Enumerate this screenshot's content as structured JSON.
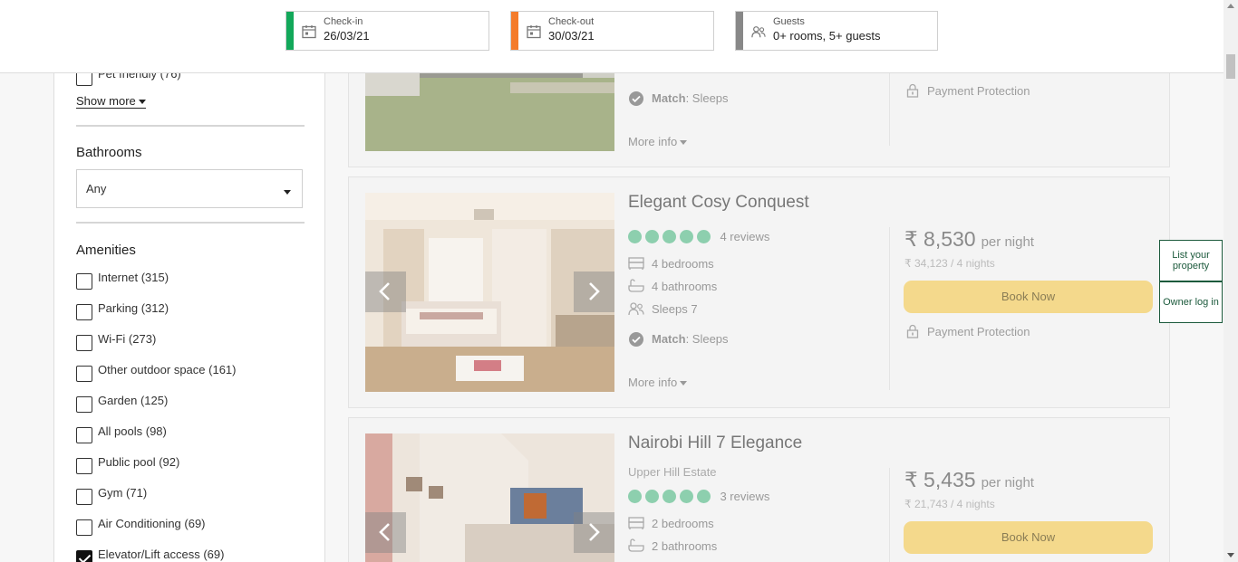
{
  "header": {
    "checkin": {
      "label": "Check-in",
      "value": "26/03/21",
      "color": "#12a85a"
    },
    "checkout": {
      "label": "Check-out",
      "value": "30/03/21",
      "color": "#f47b2a"
    },
    "guests": {
      "label": "Guests",
      "value": "0+ rooms, 5+ guests",
      "color": "#888888"
    }
  },
  "sidebar": {
    "pet_friendly": "Pet friendly (76)",
    "show_more": "Show more",
    "bathrooms_title": "Bathrooms",
    "bathrooms_value": "Any",
    "amenities_title": "Amenities",
    "amenities": [
      {
        "label": "Internet (315)",
        "checked": false
      },
      {
        "label": "Parking (312)",
        "checked": false
      },
      {
        "label": "Wi-Fi (273)",
        "checked": false
      },
      {
        "label": "Other outdoor space (161)",
        "checked": false
      },
      {
        "label": "Garden (125)",
        "checked": false
      },
      {
        "label": "All pools (98)",
        "checked": false
      },
      {
        "label": "Public pool (92)",
        "checked": false
      },
      {
        "label": "Gym (71)",
        "checked": false
      },
      {
        "label": "Air Conditioning (69)",
        "checked": false
      },
      {
        "label": "Elevator/Lift access (69)",
        "checked": true
      }
    ]
  },
  "listings": {
    "top": {
      "match_label": "Match",
      "match_value": ": Sleeps",
      "more_info": "More info",
      "payment": "Payment Protection"
    },
    "l1": {
      "title": "Elegant Cosy Conquest",
      "reviews": "4 reviews",
      "bedrooms": "4 bedrooms",
      "bathrooms": "4 bathrooms",
      "sleeps": "Sleeps 7",
      "match_label": "Match",
      "match_value": ": Sleeps",
      "more_info": "More info",
      "price": "₹ 8,530",
      "per_night": "per night",
      "total": "₹ 34,123 / 4 nights",
      "book": "Book Now",
      "payment": "Payment Protection"
    },
    "l2": {
      "title": "Nairobi Hill 7 Elegance",
      "location": "Upper Hill Estate",
      "reviews": "3 reviews",
      "bedrooms": "2 bedrooms",
      "bathrooms": "2 bathrooms",
      "price": "₹ 5,435",
      "per_night": "per night",
      "total": "₹ 21,743 / 4 nights",
      "book": "Book Now"
    }
  },
  "side_buttons": {
    "list_property": "List your property",
    "owner_login": "Owner log in"
  }
}
